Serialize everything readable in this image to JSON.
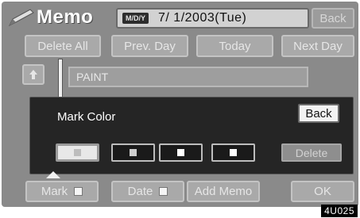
{
  "header": {
    "title": "Memo",
    "date_format": "M/D/Y",
    "date": "7/ 1/2003(Tue)",
    "back_label": "Back"
  },
  "nav": {
    "delete_all": "Delete All",
    "prev_day": "Prev. Day",
    "today": "Today",
    "next_day": "Next Day"
  },
  "memo": {
    "up_icon": "up-arrow-icon",
    "line_text": "PAINT"
  },
  "dialog": {
    "title": "Mark Color",
    "back_label": "Back",
    "delete_label": "Delete",
    "selected_swatch": 0,
    "swatches": [
      {
        "color": "#e8e8e8",
        "chip": "#bdbdbd"
      },
      {
        "color": "#1a1a1a",
        "chip": "#cfcfcf"
      },
      {
        "color": "#1a1a1a",
        "chip": "#ffffff"
      },
      {
        "color": "#1a1a1a",
        "chip": "#ffffff"
      }
    ]
  },
  "footer": {
    "mark_label": "Mark",
    "date_label": "Date",
    "add_memo_label": "Add Memo",
    "ok_label": "OK"
  },
  "figure_code": "4U025"
}
